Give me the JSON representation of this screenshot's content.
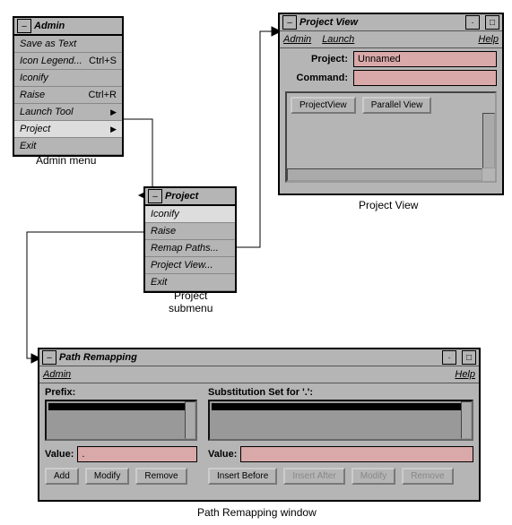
{
  "adminMenu": {
    "title": "Admin",
    "items": [
      {
        "label": "Save as Text"
      },
      {
        "label": "Icon Legend...",
        "shortcut": "Ctrl+S"
      },
      {
        "label": "Iconify"
      },
      {
        "label": "Raise",
        "shortcut": "Ctrl+R"
      },
      {
        "label": "Launch Tool",
        "arrow": true
      },
      {
        "label": "Project",
        "arrow": true
      },
      {
        "label": "Exit"
      }
    ],
    "caption": "Admin menu"
  },
  "projectMenu": {
    "title": "Project",
    "items": [
      {
        "label": "Iconify"
      },
      {
        "label": "Raise"
      },
      {
        "label": "Remap Paths..."
      },
      {
        "label": "Project View..."
      },
      {
        "label": "Exit"
      }
    ],
    "caption": "Project\nsubmenu"
  },
  "projectView": {
    "title": "Project View",
    "menus": {
      "admin": "Admin",
      "launch": "Launch",
      "help": "Help"
    },
    "fields": {
      "projectLbl": "Project:",
      "projectVal": "Unnamed",
      "commandLbl": "Command:",
      "commandVal": ""
    },
    "tabs": {
      "projectView": "ProjectView",
      "parallelView": "Parallel View"
    },
    "caption": "Project View"
  },
  "pathRemap": {
    "title": "Path Remapping",
    "menus": {
      "admin": "Admin",
      "help": "Help"
    },
    "left": {
      "header": "Prefix:",
      "valueLbl": "Value:",
      "valueVal": ".",
      "buttons": {
        "add": "Add",
        "modify": "Modify",
        "remove": "Remove"
      }
    },
    "right": {
      "header": "Substitution Set for '.':",
      "valueLbl": "Value:",
      "valueVal": "",
      "buttons": {
        "ib": "Insert Before",
        "ia": "Insert After",
        "mod": "Modify",
        "rem": "Remove"
      }
    },
    "caption": "Path Remapping window"
  }
}
